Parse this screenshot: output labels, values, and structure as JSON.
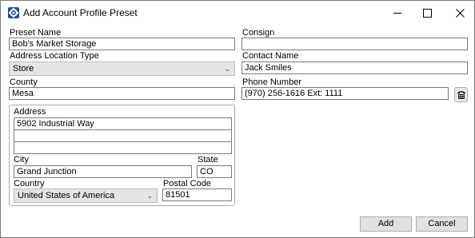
{
  "window": {
    "title": "Add Account Profile Preset",
    "app_icon": "gear-app-icon",
    "controls": [
      "minimize-icon",
      "maximize-icon",
      "close-icon"
    ]
  },
  "form": {
    "preset_name": {
      "label": "Preset Name",
      "value": "Bob's Market Storage"
    },
    "address_location_type": {
      "label": "Address Location Type",
      "value": "Store"
    },
    "county": {
      "label": "County",
      "value": "Mesa"
    },
    "consign": {
      "label": "Consign",
      "value": ""
    },
    "contact_name": {
      "label": "Contact Name",
      "value": "Jack Smiles"
    },
    "phone_number": {
      "label": "Phone Number",
      "value": "(970) 256-1616 Ext: 1111",
      "button_icon": "phone-icon"
    },
    "address": {
      "label": "Address",
      "line1": "5902 Industrial Way",
      "line2": "",
      "line3": "",
      "city": {
        "label": "City",
        "value": "Grand Junction"
      },
      "state": {
        "label": "State",
        "value": "CO"
      },
      "country": {
        "label": "Country",
        "value": "United States of America"
      },
      "postal_code": {
        "label": "Postal Code",
        "value": "81501"
      }
    }
  },
  "buttons": {
    "add": "Add",
    "cancel": "Cancel"
  }
}
